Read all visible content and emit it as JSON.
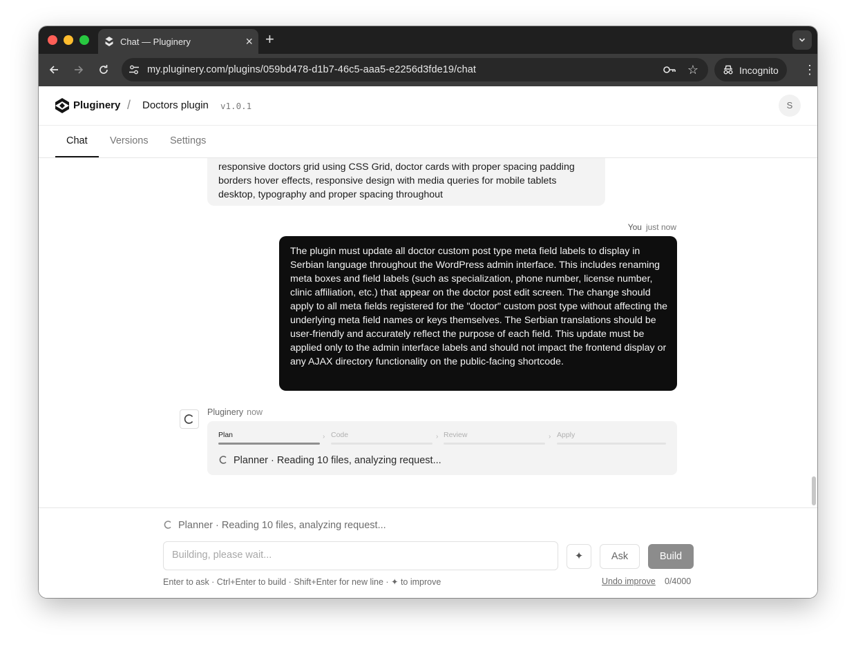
{
  "browser": {
    "tab_title": "Chat — Pluginery",
    "new_tab": "+",
    "close_tab": "×",
    "url": "my.pluginery.com/plugins/059bd478-d1b7-46c5-aaa5-e2256d3fde19/chat",
    "incognito_label": "Incognito"
  },
  "header": {
    "brand": "Pluginery",
    "separator": "/",
    "plugin_name": "Doctors plugin",
    "version": "v1.0.1",
    "avatar_initial": "S"
  },
  "tabs": [
    {
      "label": "Chat",
      "active": true
    },
    {
      "label": "Versions",
      "active": false
    },
    {
      "label": "Settings",
      "active": false
    }
  ],
  "chat": {
    "previous_message_text": "responsive doctors grid using CSS Grid, doctor cards with proper spacing padding borders hover effects, responsive design with media queries for mobile tablets desktop, typography and proper spacing throughout",
    "user_message": {
      "author": "You",
      "time": "just now",
      "text": "The plugin must update all doctor custom post type meta field labels to display in Serbian language throughout the WordPress admin interface. This includes renaming meta boxes and field labels (such as specialization, phone number, license number, clinic affiliation, etc.) that appear on the doctor post edit screen. The change should apply to all meta fields registered for the \"doctor\" custom post type without affecting the underlying meta field names or keys themselves. The Serbian translations should be user-friendly and accurately reflect the purpose of each field. This update must be applied only to the admin interface labels and should not impact the frontend display or any AJAX directory functionality on the public-facing shortcode."
    },
    "bot_message": {
      "author": "Pluginery",
      "time": "now",
      "steps": [
        {
          "label": "Plan",
          "active": true
        },
        {
          "label": "Code",
          "active": false
        },
        {
          "label": "Review",
          "active": false
        },
        {
          "label": "Apply",
          "active": false
        }
      ],
      "status": "Planner · Reading 10 files, analyzing request..."
    }
  },
  "composer": {
    "status": "Planner · Reading 10 files, analyzing request...",
    "placeholder": "Building, please wait...",
    "improve_icon": "✦",
    "ask_label": "Ask",
    "build_label": "Build",
    "hint": "Enter to ask · Ctrl+Enter to build · Shift+Enter for new line · ✦ to improve",
    "undo_label": "Undo improve",
    "counter": "0/4000"
  }
}
